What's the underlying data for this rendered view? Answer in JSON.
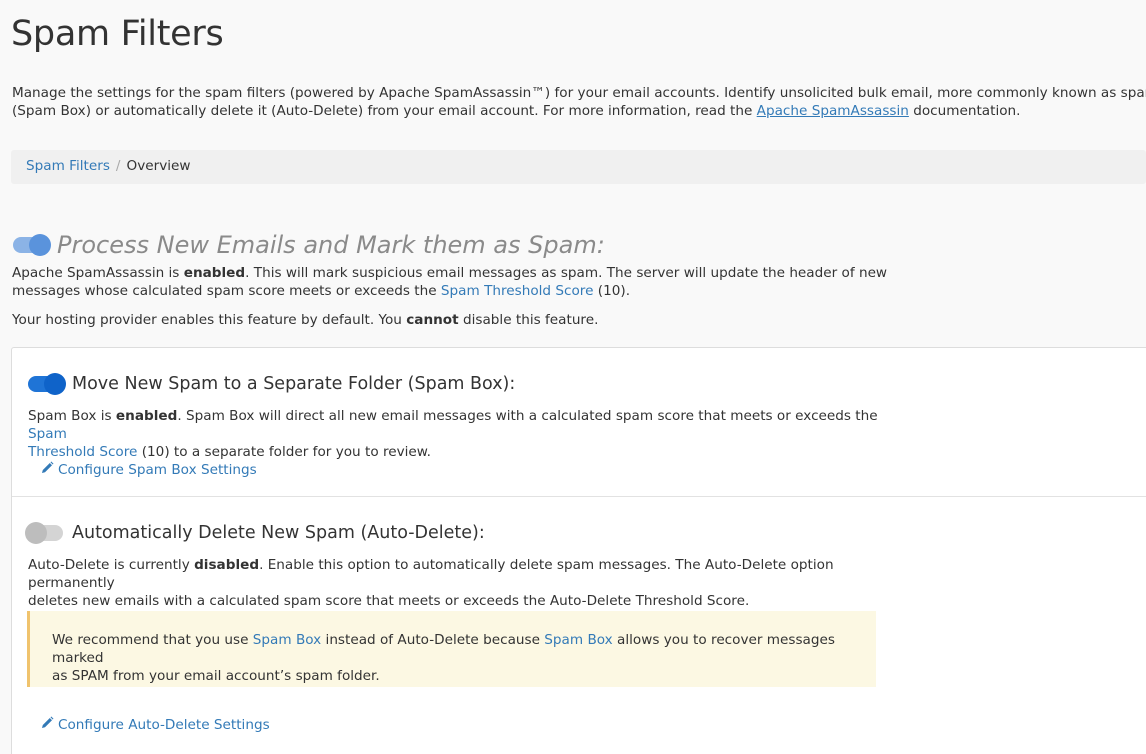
{
  "page": {
    "title": "Spam Filters",
    "intro_line1": "Manage the settings for the spam filters (powered by Apache SpamAssassin™) for your email accounts. Identify unsolicited bulk email, more commonly known as spam, and se",
    "intro_line2_prefix": "(Spam Box) or automatically delete it (Auto-Delete) from your email account. For more information, read the ",
    "intro_link": "Apache SpamAssassin",
    "intro_line2_suffix": " documentation."
  },
  "breadcrumb": {
    "parent": "Spam Filters",
    "separator": "/",
    "current": "Overview"
  },
  "process": {
    "heading": "Process New Emails and Mark them as Spam:",
    "toggle_state": "on",
    "p1_a": "Apache SpamAssassin is ",
    "p1_bold": "enabled",
    "p1_b": ". This will mark suspicious email messages as spam. The server will update the header of new",
    "p1_c": "messages whose calculated spam score meets or exceeds the ",
    "p1_link": "Spam Threshold Score",
    "p1_d": " (10).",
    "p2_a": "Your hosting provider enables this feature by default. You ",
    "p2_bold": "cannot",
    "p2_b": " disable this feature."
  },
  "spambox": {
    "heading": "Move New Spam to a Separate Folder (Spam Box):",
    "toggle_state": "on",
    "p_a": "Spam Box is ",
    "p_bold": "enabled",
    "p_b": ". Spam Box will direct all new email messages with a calculated spam score that meets or exceeds the ",
    "p_link1": "Spam",
    "p_link2": "Threshold Score",
    "p_c": " (10) to a separate folder for you to review.",
    "config_link": "Configure Spam Box Settings"
  },
  "autodelete": {
    "heading": "Automatically Delete New Spam (Auto-Delete):",
    "toggle_state": "off",
    "p_a": "Auto-Delete is currently ",
    "p_bold": "disabled",
    "p_b": ". Enable this option to automatically delete spam messages. The Auto-Delete option permanently",
    "p_c": "deletes new emails with a calculated spam score that meets or exceeds the Auto-Delete Threshold Score.",
    "notice_a": "We recommend that you use ",
    "notice_link1": "Spam Box",
    "notice_b": " instead of Auto-Delete because ",
    "notice_link2": "Spam Box",
    "notice_c": " allows you to recover messages marked",
    "notice_d": "as SPAM from your email account’s spam folder.",
    "config_link": "Configure Auto-Delete Settings"
  },
  "icons": {
    "edit": "pencil-icon"
  },
  "colors": {
    "link": "#337ab7",
    "toggle_on": "#1f74d6",
    "toggle_on_light": "#8bb3e6",
    "toggle_off": "#d4d4d4",
    "notice_bg": "#fcf8e3",
    "notice_border": "#f0c36d"
  }
}
